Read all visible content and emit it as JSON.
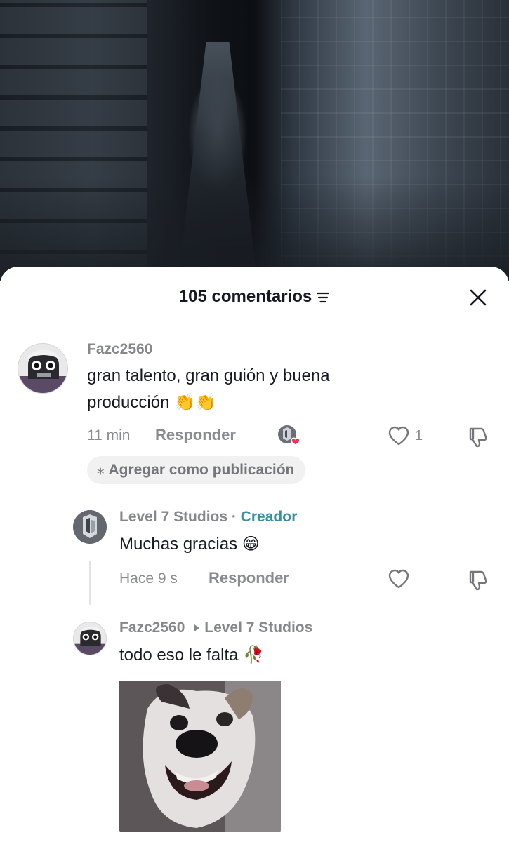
{
  "video": {
    "description_icon": "video-frame"
  },
  "header": {
    "count_title": "105 comentarios",
    "filter_icon": "filter-icon",
    "close_icon": "close-icon"
  },
  "comments": [
    {
      "username": "Fazc2560",
      "text_line1": "gran talento, gran guión y buena",
      "text_line2": "producción",
      "emoji": "👏👏",
      "time": "11 min",
      "reply_label": "Responder",
      "likes": "1",
      "action_pill": "Agregar como publicación"
    }
  ],
  "replies": [
    {
      "username": "Level 7 Studios",
      "separator": " · ",
      "badge": "Creador",
      "text": "Muchas gracias",
      "emoji": "😁",
      "time": "Hace 9 s",
      "reply_label": "Responder"
    },
    {
      "username": "Fazc2560",
      "reply_to": "Level 7 Studios",
      "text": "todo eso le falta",
      "emoji": "🥀"
    }
  ],
  "colors": {
    "creator_accent": "#3a8f9e",
    "liked_heart": "#fe2c55"
  }
}
